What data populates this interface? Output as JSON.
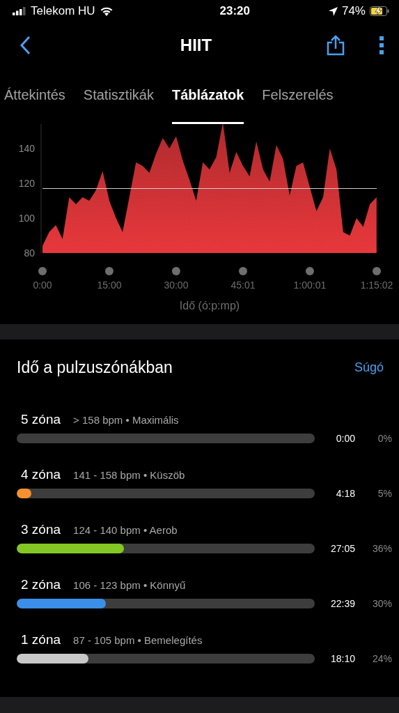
{
  "status_bar": {
    "carrier": "Telekom HU",
    "time": "23:20",
    "battery": "74%",
    "charging": true
  },
  "nav": {
    "title": "HIIT"
  },
  "tabs": [
    {
      "label": "Áttekintés",
      "selected": false
    },
    {
      "label": "Statisztikák",
      "selected": false
    },
    {
      "label": "Táblázatok",
      "selected": true
    },
    {
      "label": "Felszerelés",
      "selected": false
    }
  ],
  "chart_data": {
    "type": "area",
    "xlabel": "Idő (ó:p:mp)",
    "x": [
      0,
      90,
      180,
      270,
      360,
      450,
      540,
      630,
      720,
      810,
      900,
      990,
      1080,
      1170,
      1260,
      1350,
      1440,
      1530,
      1620,
      1710,
      1800,
      1890,
      1980,
      2070,
      2160,
      2250,
      2340,
      2430,
      2520,
      2610,
      2700,
      2790,
      2880,
      2970,
      3060,
      3150,
      3240,
      3330,
      3420,
      3510,
      3600,
      3690,
      3780,
      3870,
      3960,
      4050,
      4140,
      4230,
      4320,
      4410,
      4500
    ],
    "series": [
      {
        "color": "#e8383c",
        "values": [
          84,
          92,
          96,
          88,
          112,
          108,
          112,
          110,
          116,
          127,
          110,
          100,
          92,
          112,
          132,
          130,
          126,
          137,
          146,
          140,
          147,
          133,
          122,
          110,
          132,
          128,
          135,
          155,
          126,
          138,
          130,
          124,
          144,
          128,
          121,
          142,
          134,
          113,
          130,
          132,
          118,
          104,
          112,
          140,
          128,
          92,
          90,
          100,
          95,
          108,
          112
        ]
      }
    ],
    "xlim": [
      0,
      4502
    ],
    "ylim": [
      80,
      160
    ],
    "yticks": [
      80,
      100,
      120,
      140
    ],
    "xticks": [
      {
        "value": 0,
        "label": "0:00"
      },
      {
        "value": 900,
        "label": "15:00"
      },
      {
        "value": 1800,
        "label": "30:00"
      },
      {
        "value": 2701,
        "label": "45:01"
      },
      {
        "value": 3601,
        "label": "1:00:01"
      },
      {
        "value": 4502,
        "label": "1:15:02"
      }
    ],
    "ref_lines": [
      {
        "axis": "y",
        "value": 117
      }
    ]
  },
  "zones_card": {
    "title": "Idő a pulzuszónákban",
    "help_link": "Súgó",
    "zones": [
      {
        "name": "5 zóna",
        "range": "> 158 bpm • Maximális",
        "time": "0:00",
        "percent": "0%"
      },
      {
        "name": "4 zóna",
        "range": "141 - 158 bpm • Küszöb",
        "time": "4:18",
        "percent": "5%",
        "level": 0.05,
        "color": "#f7902f"
      },
      {
        "name": "3 zóna",
        "range": "124 - 140 bpm • Aerob",
        "time": "27:05",
        "percent": "36%",
        "level": 0.36,
        "color": "#84c724"
      },
      {
        "name": "2 zóna",
        "range": "106 - 123 bpm • Könnyű",
        "time": "22:39",
        "percent": "30%",
        "level": 0.3,
        "color": "#3b8fe8"
      },
      {
        "name": "1 zóna",
        "range": "87 - 105 bpm • Bemelegítés",
        "time": "18:10",
        "percent": "24%",
        "level": 0.24,
        "color": "#c8c8c8"
      }
    ]
  }
}
